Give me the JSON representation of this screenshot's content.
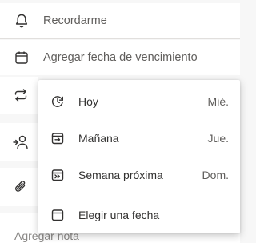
{
  "detail": {
    "remind_label": "Recordarme",
    "due_label": "Agregar fecha de vencimiento",
    "note_placeholder": "Agregar nota"
  },
  "icons": {
    "remind": "bell-icon",
    "due": "calendar-icon",
    "repeat": "repeat-icon",
    "assign": "assign-person-icon",
    "attach": "paperclip-icon"
  },
  "due_menu": {
    "items": [
      {
        "label": "Hoy",
        "day": "Mié.",
        "icon": "calendar-today-icon"
      },
      {
        "label": "Mañana",
        "day": "Jue.",
        "icon": "calendar-tomorrow-icon"
      },
      {
        "label": "Semana próxima",
        "day": "Dom.",
        "icon": "calendar-next-week-icon"
      },
      {
        "label": "Elegir una fecha",
        "icon": "calendar-pick-icon"
      }
    ]
  },
  "colors": {
    "background": "#f7f7f7",
    "surface": "#ffffff",
    "text": "#323130",
    "muted": "#605e5c",
    "divider": "#e1dfdd"
  }
}
